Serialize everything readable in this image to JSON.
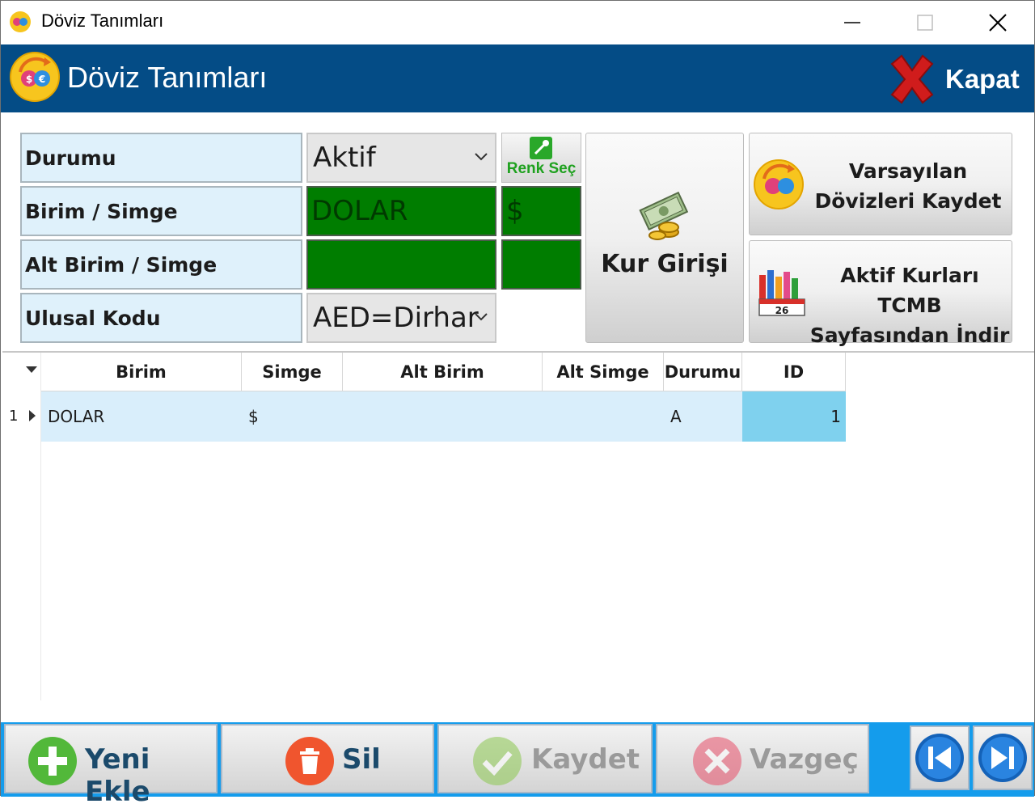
{
  "window": {
    "title": "Döviz Tanımları"
  },
  "header": {
    "title": "Döviz Tanımları",
    "close_label": "Kapat"
  },
  "form": {
    "durumu_label": "Durumu",
    "durumu_value": "Aktif",
    "birim_label": "Birim / Simge",
    "birim_value": "DOLAR",
    "simge_value": "$",
    "alt_birim_label": "Alt Birim / Simge",
    "alt_birim_value": "",
    "alt_simge_value": "",
    "ulusal_label": "Ulusal Kodu",
    "ulusal_value": "AED=Dirhar",
    "renk_sec_label": "Renk Seç",
    "selected_color": "#007d00"
  },
  "actions": {
    "kur_girisi": "Kur Girişi",
    "varsayilan_line1": "Varsayılan",
    "varsayilan_line2": "Dövizleri Kaydet",
    "tcmb_line1": "Aktif Kurları TCMB",
    "tcmb_line2": "Sayfasından İndir",
    "calendar_day": "26"
  },
  "grid": {
    "columns": [
      "Birim",
      "Simge",
      "Alt Birim",
      "Alt Simge",
      "Durumu",
      "ID"
    ],
    "rows": [
      {
        "num": "1",
        "birim": "DOLAR",
        "simge": "$",
        "alt_birim": "",
        "alt_simge": "",
        "durumu": "A",
        "id": "1"
      }
    ]
  },
  "toolbar": {
    "yeni_ekle": "Yeni Ekle",
    "sil": "Sil",
    "kaydet": "Kaydet",
    "vazgec": "Vazgeç"
  },
  "colors": {
    "header_bg": "#044c86",
    "toolbar_bg": "#149cec",
    "label_bg": "#dff1fb",
    "selected_row": "#d9eefb",
    "id_cell": "#7fd1ee"
  }
}
